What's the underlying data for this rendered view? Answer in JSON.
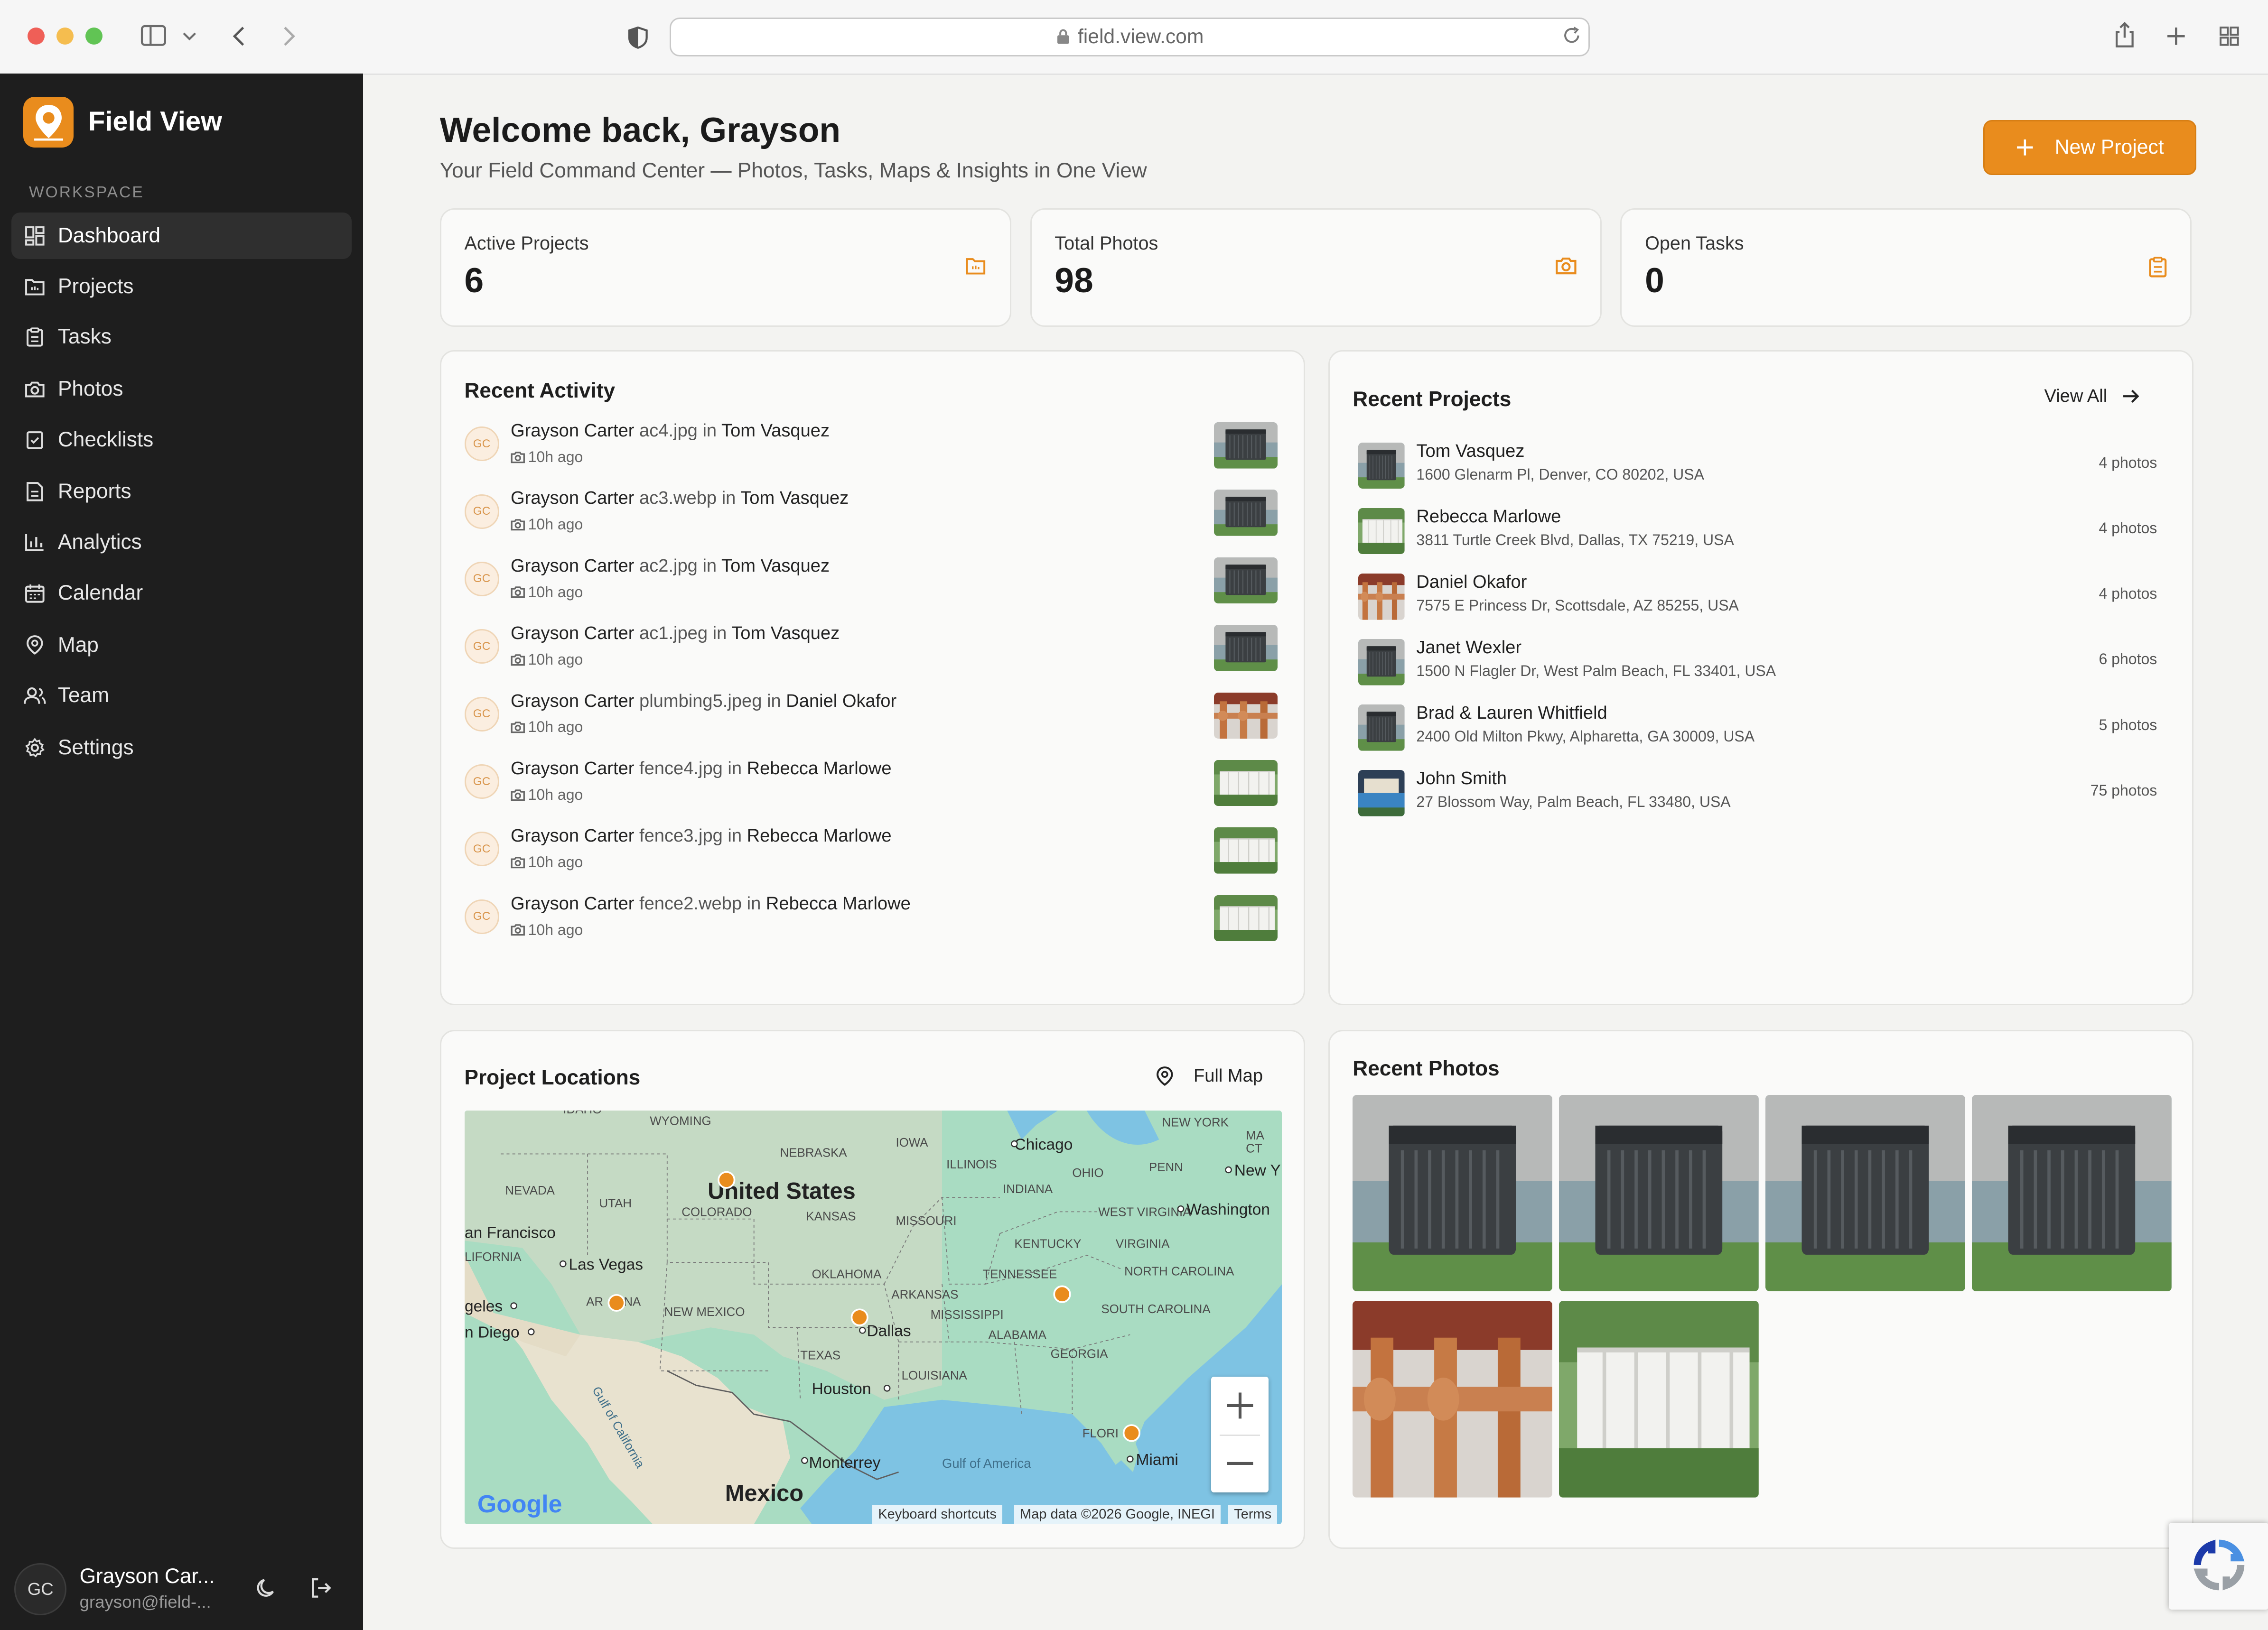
{
  "browser": {
    "url": "field.view.com"
  },
  "sidebar": {
    "brand": "Field View",
    "section_label": "WORKSPACE",
    "items": [
      {
        "label": "Dashboard",
        "icon": "dashboard-icon",
        "active": true
      },
      {
        "label": "Projects",
        "icon": "folder-icon"
      },
      {
        "label": "Tasks",
        "icon": "clipboard-icon"
      },
      {
        "label": "Photos",
        "icon": "camera-icon"
      },
      {
        "label": "Checklists",
        "icon": "checklist-icon"
      },
      {
        "label": "Reports",
        "icon": "report-icon"
      },
      {
        "label": "Analytics",
        "icon": "bar-chart-icon"
      },
      {
        "label": "Calendar",
        "icon": "calendar-icon"
      },
      {
        "label": "Map",
        "icon": "map-pin-icon"
      },
      {
        "label": "Team",
        "icon": "team-icon"
      },
      {
        "label": "Settings",
        "icon": "gear-icon"
      }
    ],
    "user": {
      "initials": "GC",
      "name": "Grayson Car...",
      "email": "grayson@field-..."
    }
  },
  "header": {
    "title": "Welcome back, Grayson",
    "subtitle": "Your Field Command Center — Photos, Tasks, Maps & Insights in One View",
    "new_project_label": "New Project"
  },
  "stats": [
    {
      "label": "Active Projects",
      "value": "6",
      "icon": "folder-icon"
    },
    {
      "label": "Total Photos",
      "value": "98",
      "icon": "camera-icon"
    },
    {
      "label": "Open Tasks",
      "value": "0",
      "icon": "clipboard-icon"
    }
  ],
  "recent_activity": {
    "title": "Recent Activity",
    "items": [
      {
        "initials": "GC",
        "user": "Grayson Carter",
        "file": "ac4.jpg",
        "sep": "in",
        "project": "Tom Vasquez",
        "time": "10h ago",
        "thumb": "ac-unit"
      },
      {
        "initials": "GC",
        "user": "Grayson Carter",
        "file": "ac3.webp",
        "sep": "in",
        "project": "Tom Vasquez",
        "time": "10h ago",
        "thumb": "ac-unit"
      },
      {
        "initials": "GC",
        "user": "Grayson Carter",
        "file": "ac2.jpg",
        "sep": "in",
        "project": "Tom Vasquez",
        "time": "10h ago",
        "thumb": "ac-unit"
      },
      {
        "initials": "GC",
        "user": "Grayson Carter",
        "file": "ac1.jpeg",
        "sep": "in",
        "project": "Tom Vasquez",
        "time": "10h ago",
        "thumb": "ac-unit"
      },
      {
        "initials": "GC",
        "user": "Grayson Carter",
        "file": "plumbing5.jpeg",
        "sep": "in",
        "project": "Daniel Okafor",
        "time": "10h ago",
        "thumb": "plumbing"
      },
      {
        "initials": "GC",
        "user": "Grayson Carter",
        "file": "fence4.jpg",
        "sep": "in",
        "project": "Rebecca Marlowe",
        "time": "10h ago",
        "thumb": "fence"
      },
      {
        "initials": "GC",
        "user": "Grayson Carter",
        "file": "fence3.jpg",
        "sep": "in",
        "project": "Rebecca Marlowe",
        "time": "10h ago",
        "thumb": "fence"
      },
      {
        "initials": "GC",
        "user": "Grayson Carter",
        "file": "fence2.webp",
        "sep": "in",
        "project": "Rebecca Marlowe",
        "time": "10h ago",
        "thumb": "fence"
      }
    ]
  },
  "recent_projects": {
    "title": "Recent Projects",
    "view_all": "View All",
    "items": [
      {
        "name": "Tom Vasquez",
        "address": "1600 Glenarm Pl, Denver, CO 80202, USA",
        "count": "4 photos"
      },
      {
        "name": "Rebecca Marlowe",
        "address": "3811 Turtle Creek Blvd, Dallas, TX 75219, USA",
        "count": "4 photos"
      },
      {
        "name": "Daniel Okafor",
        "address": "7575 E Princess Dr, Scottsdale, AZ 85255, USA",
        "count": "4 photos"
      },
      {
        "name": "Janet Wexler",
        "address": "1500 N Flagler Dr, West Palm Beach, FL 33401, USA",
        "count": "6 photos"
      },
      {
        "name": "Brad & Lauren Whitfield",
        "address": "2400 Old Milton Pkwy, Alpharetta, GA 30009, USA",
        "count": "5 photos"
      },
      {
        "name": "John Smith",
        "address": "27 Blossom Way, Palm Beach, FL 33480, USA",
        "count": "75 photos"
      }
    ]
  },
  "project_locations": {
    "title": "Project Locations",
    "full_map": "Full Map",
    "map_labels": {
      "country": "United States",
      "mexico": "Mexico",
      "s1": "WYOMING",
      "s2": "NEBRASKA",
      "s3": "IOWA",
      "s4": "ILLINOIS",
      "s5": "OHIO",
      "s6": "PENN",
      "s7": "NEVADA",
      "s8": "UTAH",
      "s9": "COLORADO",
      "s10": "KANSAS",
      "s11": "MISSOURI",
      "s12": "INDIANA",
      "s13": "KENTUCKY",
      "s14": "VIRGINIA",
      "s15": "WEST VIRGINIA",
      "s16": "OKLAHOMA",
      "s17": "ARKANSAS",
      "s18": "TENNESSEE",
      "s19": "NORTH CAROLINA",
      "s20": "SOUTH CAROLINA",
      "s21": "MISSISSIPPI",
      "s22": "ALABAMA",
      "s23": "GEORGIA",
      "s24": "TEXAS",
      "s25": "LOUISIANA",
      "s26": "NEW MEXICO",
      "s27": "LIFORNIA",
      "s28": "IDAHO",
      "s29": "NEW YORK",
      "s30": "MA",
      "s31": "CT",
      "s32": "FLORI",
      "c1": "Chicago",
      "c2": "New Y",
      "c3": "Washington",
      "c4": "an Francisco",
      "c5": "Las Vegas",
      "c6": "geles",
      "c7": "n Diego",
      "c8": "Dallas",
      "c9": "Houston",
      "c10": "Monterrey",
      "c11": "Miami",
      "c12": "Gulf of America",
      "c13": "Gulf of California",
      "c14": "AR",
      "c15": "NA"
    },
    "attribution": [
      "Keyboard shortcuts",
      "Map data ©2026 Google, INEGI",
      "Terms"
    ],
    "google": "Google"
  },
  "recent_photos": {
    "title": "Recent Photos",
    "photos": [
      "ac-unit-1",
      "ac-unit-2",
      "ac-unit-3",
      "ac-unit-4",
      "copper-pipes",
      "white-fence"
    ]
  },
  "colors": {
    "accent": "#e98c1d",
    "sidebar": "#1e1e1e",
    "map_water": "#7ec3e3",
    "map_land": "#a9dcc2"
  }
}
